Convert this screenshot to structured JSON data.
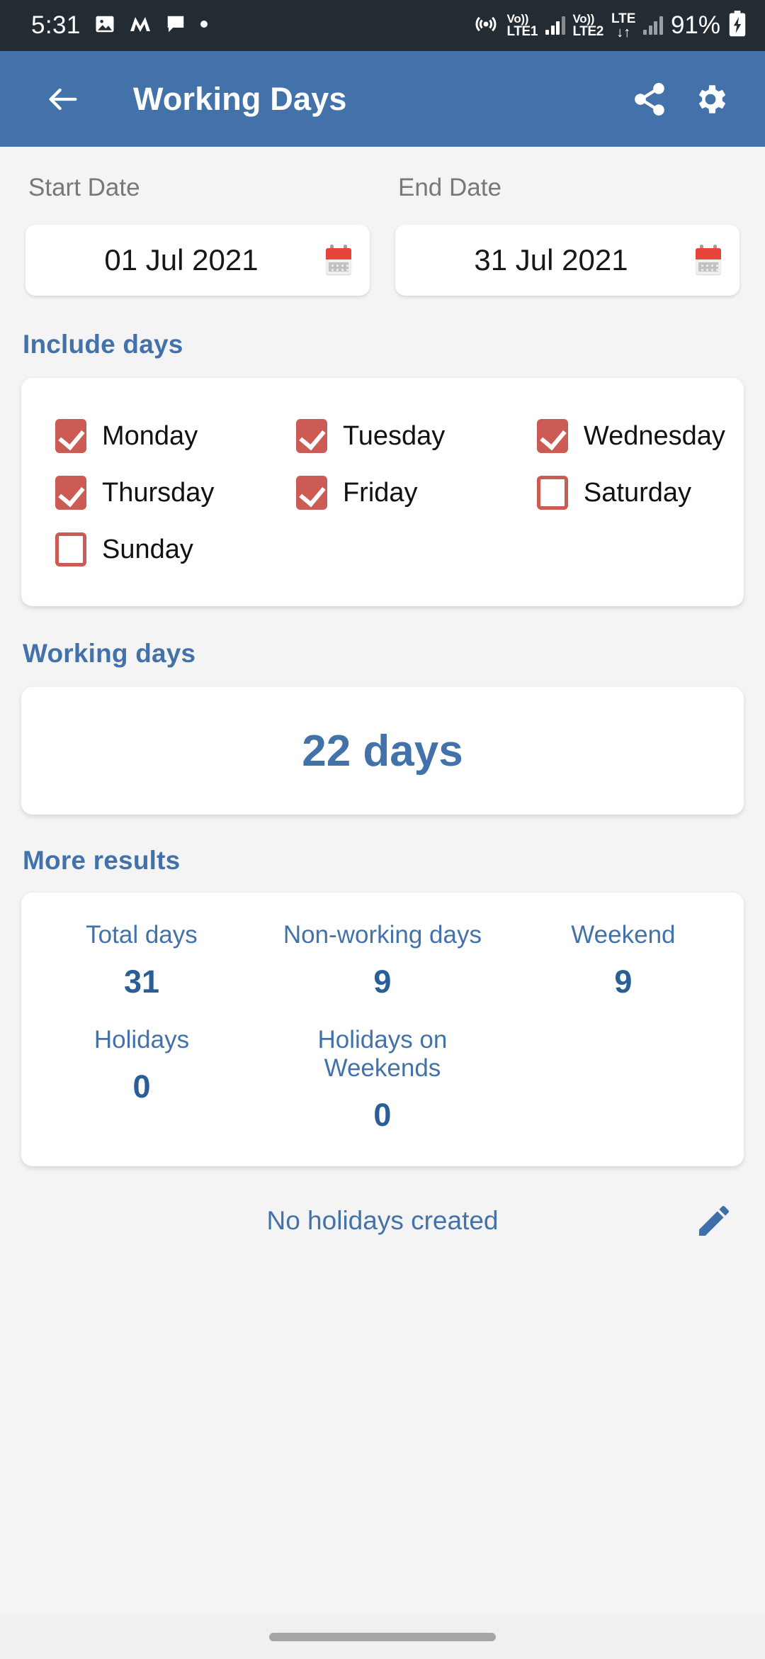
{
  "status_bar": {
    "time": "5:31",
    "left_icons": [
      "image-icon",
      "m-app-icon",
      "message-icon",
      "dot-icon"
    ],
    "hotspot_icon": "hotspot-icon",
    "sim1": {
      "volte_top": "Vo))",
      "volte_bottom": "LTE1"
    },
    "sim2": {
      "volte_top": "Vo))",
      "volte_bottom": "LTE2"
    },
    "network": {
      "label": "LTE",
      "data_arrows": "↓↑"
    },
    "battery_percent": "91%",
    "battery_icon": "battery-charging-icon"
  },
  "app_bar": {
    "back_icon": "back-arrow-icon",
    "title": "Working Days",
    "share_icon": "share-icon",
    "settings_icon": "gear-icon"
  },
  "dates": {
    "start": {
      "label": "Start Date",
      "value": "01 Jul 2021",
      "icon": "calendar-icon"
    },
    "end": {
      "label": "End Date",
      "value": "31 Jul 2021",
      "icon": "calendar-icon"
    }
  },
  "include_days": {
    "title": "Include days",
    "items": [
      {
        "label": "Monday",
        "checked": true
      },
      {
        "label": "Tuesday",
        "checked": true
      },
      {
        "label": "Wednesday",
        "checked": true
      },
      {
        "label": "Thursday",
        "checked": true
      },
      {
        "label": "Friday",
        "checked": true
      },
      {
        "label": "Saturday",
        "checked": false
      },
      {
        "label": "Sunday",
        "checked": false
      }
    ]
  },
  "working_days": {
    "title": "Working days",
    "value": "22 days"
  },
  "more_results": {
    "title": "More results",
    "row1": [
      {
        "key": "Total days",
        "value": "31"
      },
      {
        "key": "Non-working days",
        "value": "9"
      },
      {
        "key": "Weekend",
        "value": "9"
      }
    ],
    "row2": [
      {
        "key": "Holidays",
        "value": "0"
      },
      {
        "key": "Holidays on Weekends",
        "value": "0"
      }
    ]
  },
  "holidays_footer": {
    "text": "No holidays created",
    "edit_icon": "pencil-icon"
  },
  "colors": {
    "app_bar": "#4372AA",
    "accent_blue": "#4372AA",
    "value_blue": "#2B5E96",
    "checkbox_red": "#CC5B55",
    "page_bg": "#F4F4F4",
    "status_bar_bg": "#232C33",
    "calendar_red": "#E7443C"
  }
}
